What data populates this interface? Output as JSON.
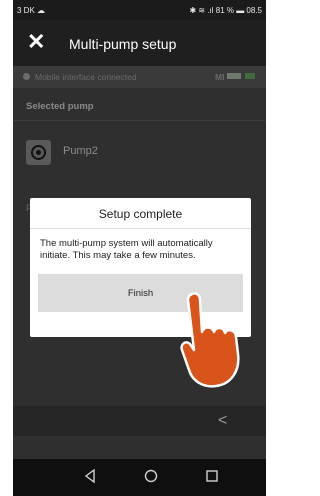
{
  "status_bar": {
    "left": "3 DK ☁",
    "right": "✱ ≋ .ıl 81 % ▬ 08.5"
  },
  "app_bar": {
    "title": "Multi-pump setup"
  },
  "connection": {
    "text": "Mobile interface connected",
    "mi_label": "MI"
  },
  "selected_pump": {
    "label": "Selected pump",
    "name": "Pump2",
    "icon": "pump-icon"
  },
  "background_letter": "F",
  "dialog": {
    "title": "Setup complete",
    "message": "The multi-pump system will automatically initiate. This may take a few minutes.",
    "finish_label": "Finish"
  },
  "bottom_bar": {
    "back_glyph": "<"
  },
  "colors": {
    "hand_fill": "#d9541a",
    "dialog_bg": "#ffffff",
    "button_bg": "#dcdcdc",
    "app_bg": "#2f2f2f"
  }
}
